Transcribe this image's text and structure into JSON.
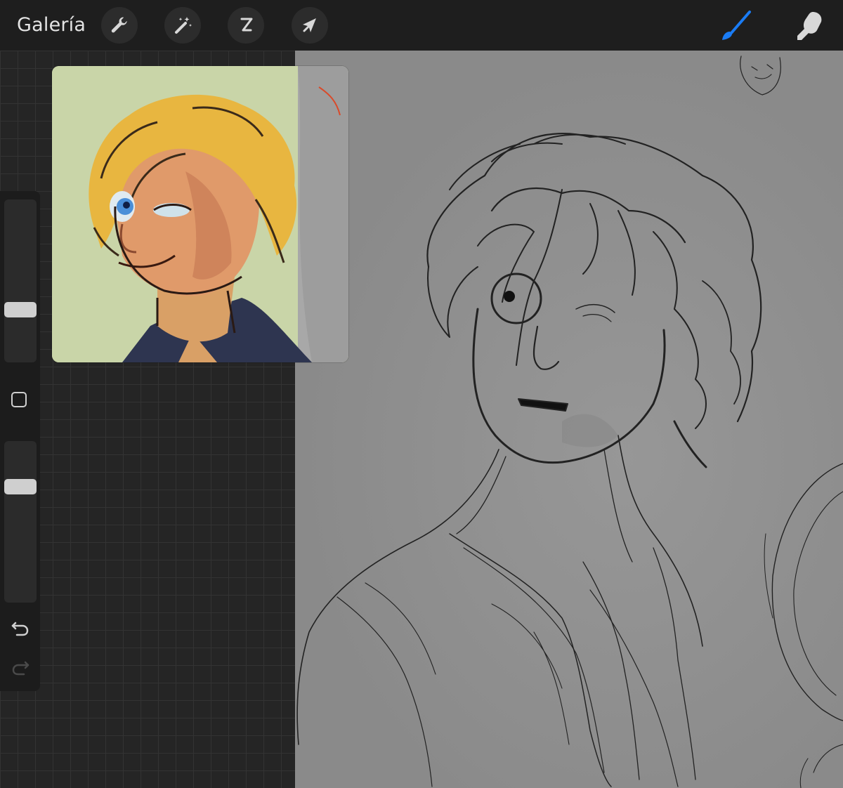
{
  "toolbar": {
    "gallery_label": "Galería",
    "left_tools": [
      {
        "name": "actions",
        "icon": "wrench-icon"
      },
      {
        "name": "adjustments",
        "icon": "magic-wand-icon"
      },
      {
        "name": "selection",
        "icon": "selection-s-icon"
      },
      {
        "name": "transform",
        "icon": "arrow-cursor-icon"
      }
    ],
    "right_tools": [
      {
        "name": "brush",
        "icon": "brush-icon",
        "active": true
      },
      {
        "name": "smudge",
        "icon": "smudge-finger-icon",
        "active": false
      }
    ],
    "accent_color": "#1a7cf5"
  },
  "sidebar": {
    "brush_size_level": 0.65,
    "opacity_level": 0.3,
    "modify_button_icon": "square-icon",
    "undo_icon": "undo-arrow-icon",
    "redo_icon": "redo-arrow-icon"
  },
  "reference_window": {
    "image": "colored-portrait-blond-curly-hair",
    "background_color": "#c9d5a8"
  },
  "canvas": {
    "image": "pencil-sketch-curly-hair-character",
    "background_color": "#8c8c8c"
  }
}
